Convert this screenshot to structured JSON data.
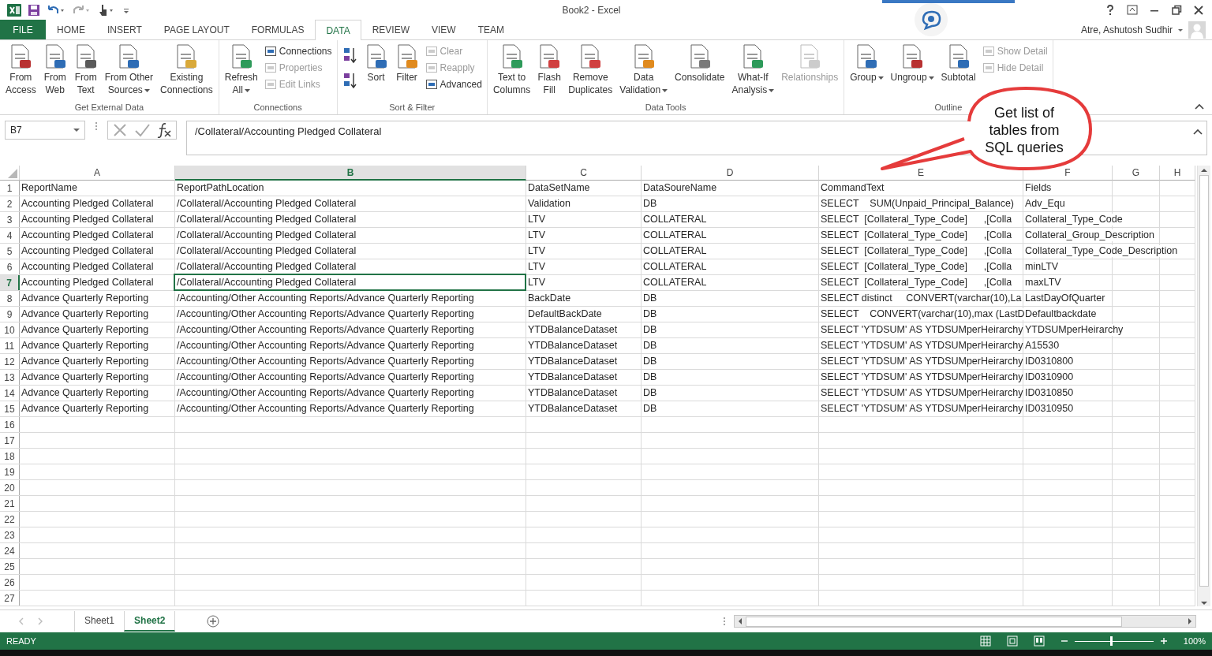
{
  "window": {
    "title": "Book2 - Excel",
    "user": "Atre, Ashutosh Sudhir"
  },
  "tabs": [
    {
      "label": "FILE",
      "kind": "file",
      "selected": false
    },
    {
      "label": "HOME",
      "kind": "tab",
      "selected": false
    },
    {
      "label": "INSERT",
      "kind": "tab",
      "selected": false
    },
    {
      "label": "PAGE LAYOUT",
      "kind": "tab",
      "selected": false
    },
    {
      "label": "FORMULAS",
      "kind": "tab",
      "selected": false
    },
    {
      "label": "DATA",
      "kind": "tab",
      "selected": true
    },
    {
      "label": "REVIEW",
      "kind": "tab",
      "selected": false
    },
    {
      "label": "VIEW",
      "kind": "tab",
      "selected": false
    },
    {
      "label": "TEAM",
      "kind": "tab",
      "selected": false
    }
  ],
  "ribbon": [
    {
      "label": "Get External Data",
      "items": [
        {
          "kind": "large",
          "lines": [
            "From",
            "Access"
          ],
          "dropdown": false,
          "disabled": false
        },
        {
          "kind": "large",
          "lines": [
            "From",
            "Web"
          ],
          "dropdown": false,
          "disabled": false
        },
        {
          "kind": "large",
          "lines": [
            "From",
            "Text"
          ],
          "dropdown": false,
          "disabled": false
        },
        {
          "kind": "large",
          "lines": [
            "From Other",
            "Sources"
          ],
          "dropdown": true,
          "disabled": false
        },
        {
          "kind": "large",
          "lines": [
            "Existing",
            "Connections"
          ],
          "dropdown": false,
          "disabled": false
        }
      ]
    },
    {
      "label": "Connections",
      "items": [
        {
          "kind": "large",
          "lines": [
            "Refresh",
            "All"
          ],
          "dropdown": true,
          "disabled": false
        },
        {
          "kind": "stack",
          "buttons": [
            {
              "label": "Connections",
              "disabled": false
            },
            {
              "label": "Properties",
              "disabled": true
            },
            {
              "label": "Edit Links",
              "disabled": true
            }
          ]
        }
      ]
    },
    {
      "label": "Sort & Filter",
      "items": [
        {
          "kind": "sort_pair"
        },
        {
          "kind": "large",
          "lines": [
            "Sort"
          ],
          "dropdown": false,
          "disabled": false
        },
        {
          "kind": "large",
          "lines": [
            "Filter"
          ],
          "dropdown": false,
          "disabled": false
        },
        {
          "kind": "stack",
          "buttons": [
            {
              "label": "Clear",
              "disabled": true
            },
            {
              "label": "Reapply",
              "disabled": true
            },
            {
              "label": "Advanced",
              "disabled": false
            }
          ]
        }
      ]
    },
    {
      "label": "Data Tools",
      "items": [
        {
          "kind": "large",
          "lines": [
            "Text to",
            "Columns"
          ],
          "dropdown": false,
          "disabled": false
        },
        {
          "kind": "large",
          "lines": [
            "Flash",
            "Fill"
          ],
          "dropdown": false,
          "disabled": false
        },
        {
          "kind": "large",
          "lines": [
            "Remove",
            "Duplicates"
          ],
          "dropdown": false,
          "disabled": false
        },
        {
          "kind": "large",
          "lines": [
            "Data",
            "Validation"
          ],
          "dropdown": true,
          "disabled": false
        },
        {
          "kind": "large",
          "lines": [
            "Consolidate"
          ],
          "dropdown": false,
          "disabled": false
        },
        {
          "kind": "large",
          "lines": [
            "What-If",
            "Analysis"
          ],
          "dropdown": true,
          "disabled": false
        },
        {
          "kind": "large",
          "lines": [
            "Relationships"
          ],
          "dropdown": false,
          "disabled": true
        }
      ]
    },
    {
      "label": "Outline",
      "items": [
        {
          "kind": "large",
          "lines": [
            "Group"
          ],
          "dropdown": true,
          "disabled": false
        },
        {
          "kind": "large",
          "lines": [
            "Ungroup"
          ],
          "dropdown": true,
          "disabled": false
        },
        {
          "kind": "large",
          "lines": [
            "Subtotal"
          ],
          "dropdown": false,
          "disabled": false
        },
        {
          "kind": "stack",
          "buttons": [
            {
              "label": "Show Detail",
              "disabled": true
            },
            {
              "label": "Hide Detail",
              "disabled": true
            }
          ]
        }
      ]
    }
  ],
  "formula_bar": {
    "name_box": "B7",
    "formula": "/Collateral/Accounting Pledged Collateral"
  },
  "columns": [
    {
      "label": "A",
      "selected": false
    },
    {
      "label": "B",
      "selected": true
    },
    {
      "label": "C",
      "selected": false
    },
    {
      "label": "D",
      "selected": false
    },
    {
      "label": "E",
      "selected": false
    },
    {
      "label": "F",
      "selected": false
    },
    {
      "label": "G",
      "selected": false
    },
    {
      "label": "H",
      "selected": false
    }
  ],
  "rows": [
    {
      "number": "1",
      "selected": false,
      "cells": [
        "ReportName",
        "ReportPathLocation",
        "DataSetName",
        "DataSoureName",
        "CommandText",
        "Fields"
      ]
    },
    {
      "number": "2",
      "selected": false,
      "cells": [
        "Accounting Pledged Collateral",
        "/Collateral/Accounting Pledged Collateral",
        "Validation",
        "DB",
        "SELECT    SUM(Unpaid_Principal_Balance)",
        "Adv_Equ"
      ]
    },
    {
      "number": "3",
      "selected": false,
      "cells": [
        "Accounting Pledged Collateral",
        "/Collateral/Accounting Pledged Collateral",
        "LTV",
        "COLLATERAL",
        "SELECT  [Collateral_Type_Code]      ,[Colla",
        "Collateral_Type_Code"
      ]
    },
    {
      "number": "4",
      "selected": false,
      "cells": [
        "Accounting Pledged Collateral",
        "/Collateral/Accounting Pledged Collateral",
        "LTV",
        "COLLATERAL",
        "SELECT  [Collateral_Type_Code]      ,[Colla",
        "Collateral_Group_Description"
      ]
    },
    {
      "number": "5",
      "selected": false,
      "cells": [
        "Accounting Pledged Collateral",
        "/Collateral/Accounting Pledged Collateral",
        "LTV",
        "COLLATERAL",
        "SELECT  [Collateral_Type_Code]      ,[Colla",
        "Collateral_Type_Code_Description"
      ]
    },
    {
      "number": "6",
      "selected": false,
      "cells": [
        "Accounting Pledged Collateral",
        "/Collateral/Accounting Pledged Collateral",
        "LTV",
        "COLLATERAL",
        "SELECT  [Collateral_Type_Code]      ,[Colla",
        "minLTV"
      ]
    },
    {
      "number": "7",
      "selected": true,
      "cells": [
        "Accounting Pledged Collateral",
        "/Collateral/Accounting Pledged Collateral",
        "LTV",
        "COLLATERAL",
        "SELECT  [Collateral_Type_Code]      ,[Colla",
        "maxLTV"
      ]
    },
    {
      "number": "8",
      "selected": false,
      "cells": [
        "Advance Quarterly Reporting",
        "/Accounting/Other Accounting Reports/Advance Quarterly Reporting",
        "BackDate",
        "DB",
        "SELECT distinct     CONVERT(varchar(10),La",
        "LastDayOfQuarter"
      ]
    },
    {
      "number": "9",
      "selected": false,
      "cells": [
        "Advance Quarterly Reporting",
        "/Accounting/Other Accounting Reports/Advance Quarterly Reporting",
        "DefaultBackDate",
        "DB",
        "SELECT    CONVERT(varchar(10),max (LastD",
        "Defaultbackdate"
      ]
    },
    {
      "number": "10",
      "selected": false,
      "cells": [
        "Advance Quarterly Reporting",
        "/Accounting/Other Accounting Reports/Advance Quarterly Reporting",
        "YTDBalanceDataset",
        "DB",
        "SELECT 'YTDSUM' AS YTDSUMperHeirarchy",
        "YTDSUMperHeirarchy"
      ]
    },
    {
      "number": "11",
      "selected": false,
      "cells": [
        "Advance Quarterly Reporting",
        "/Accounting/Other Accounting Reports/Advance Quarterly Reporting",
        "YTDBalanceDataset",
        "DB",
        "SELECT 'YTDSUM' AS YTDSUMperHeirarchy",
        "A15530"
      ]
    },
    {
      "number": "12",
      "selected": false,
      "cells": [
        "Advance Quarterly Reporting",
        "/Accounting/Other Accounting Reports/Advance Quarterly Reporting",
        "YTDBalanceDataset",
        "DB",
        "SELECT 'YTDSUM' AS YTDSUMperHeirarchy",
        "ID0310800"
      ]
    },
    {
      "number": "13",
      "selected": false,
      "cells": [
        "Advance Quarterly Reporting",
        "/Accounting/Other Accounting Reports/Advance Quarterly Reporting",
        "YTDBalanceDataset",
        "DB",
        "SELECT 'YTDSUM' AS YTDSUMperHeirarchy",
        "ID0310900"
      ]
    },
    {
      "number": "14",
      "selected": false,
      "cells": [
        "Advance Quarterly Reporting",
        "/Accounting/Other Accounting Reports/Advance Quarterly Reporting",
        "YTDBalanceDataset",
        "DB",
        "SELECT 'YTDSUM' AS YTDSUMperHeirarchy",
        "ID0310850"
      ]
    },
    {
      "number": "15",
      "selected": false,
      "cells": [
        "Advance Quarterly Reporting",
        "/Accounting/Other Accounting Reports/Advance Quarterly Reporting",
        "YTDBalanceDataset",
        "DB",
        "SELECT 'YTDSUM' AS YTDSUMperHeirarchy",
        "ID0310950"
      ]
    },
    {
      "number": "16",
      "selected": false
    },
    {
      "number": "17",
      "selected": false
    },
    {
      "number": "18",
      "selected": false
    },
    {
      "number": "19",
      "selected": false
    },
    {
      "number": "20",
      "selected": false
    },
    {
      "number": "21",
      "selected": false
    },
    {
      "number": "22",
      "selected": false
    },
    {
      "number": "23",
      "selected": false
    },
    {
      "number": "24",
      "selected": false
    },
    {
      "number": "25",
      "selected": false
    },
    {
      "number": "26",
      "selected": false
    },
    {
      "number": "27",
      "selected": false
    }
  ],
  "callout": {
    "text": "Get list of tables from SQL queries"
  },
  "sheets": [
    {
      "label": "Sheet1",
      "selected": false
    },
    {
      "label": "Sheet2",
      "selected": true
    }
  ],
  "status_bar": {
    "status": "READY",
    "zoom": "100%",
    "zoom_slider": {
      "level": 0.45
    }
  }
}
